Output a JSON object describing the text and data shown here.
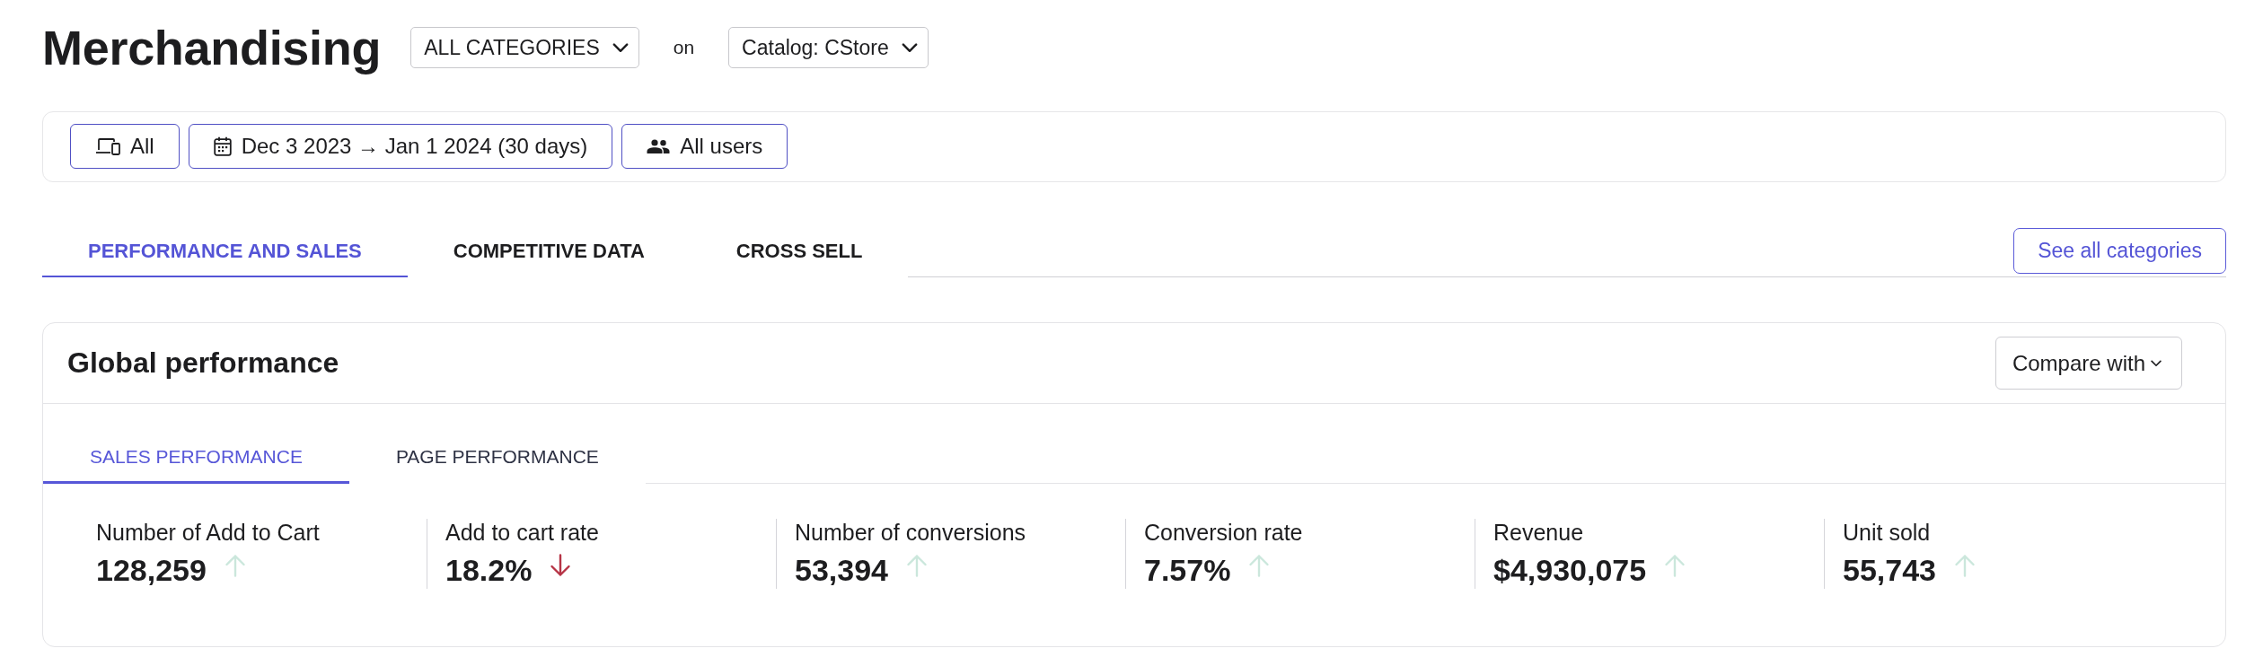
{
  "header": {
    "title": "Merchandising",
    "category_dropdown": {
      "value": "ALL CATEGORIES"
    },
    "joiner": "on",
    "catalog_dropdown": {
      "value": "Catalog: CStore"
    }
  },
  "filters": [
    {
      "kind": "device",
      "label": "All"
    },
    {
      "kind": "date",
      "label": "Dec 3 2023 → Jan 1 2024 (30 days)"
    },
    {
      "kind": "audience",
      "label": "All users"
    }
  ],
  "tabs": [
    {
      "label": "PERFORMANCE AND SALES",
      "selected": true
    },
    {
      "label": "COMPETITIVE DATA",
      "selected": false
    },
    {
      "label": "CROSS SELL",
      "selected": false
    }
  ],
  "tabs_action": {
    "label": "See all categories"
  },
  "panel": {
    "title": "Global performance",
    "compare_button": {
      "label": "Compare with"
    },
    "tabs": [
      {
        "label": "SALES PERFORMANCE",
        "selected": true
      },
      {
        "label": "PAGE PERFORMANCE",
        "selected": false
      }
    ],
    "metrics": [
      {
        "kind": "up",
        "label": "Number of Add to Cart",
        "value": "128,259"
      },
      {
        "kind": "down",
        "label": "Add to cart rate",
        "value": "18.2%"
      },
      {
        "kind": "up",
        "label": "Number of conversions",
        "value": "53,394"
      },
      {
        "kind": "up",
        "label": "Conversion rate",
        "value": "7.57%"
      },
      {
        "kind": "up",
        "label": "Revenue",
        "value": "$4,930,075"
      },
      {
        "kind": "up",
        "label": "Unit sold",
        "value": "55,743"
      }
    ]
  }
}
